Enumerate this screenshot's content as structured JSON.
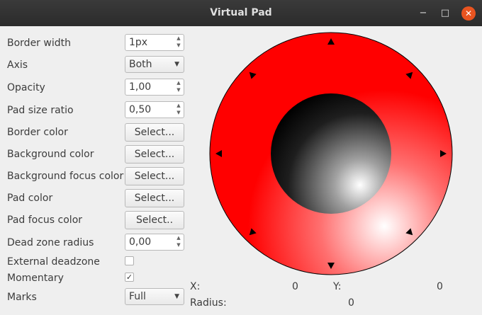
{
  "window": {
    "title": "Virtual Pad",
    "minimize": "−",
    "maximize": "□",
    "close": "✕"
  },
  "settings": {
    "border_width": {
      "label": "Border width",
      "value": "1px"
    },
    "axis": {
      "label": "Axis",
      "value": "Both"
    },
    "opacity": {
      "label": "Opacity",
      "value": "1,00"
    },
    "pad_size_ratio": {
      "label": "Pad size ratio",
      "value": "0,50"
    },
    "border_color": {
      "label": "Border color",
      "button": "Select..."
    },
    "background_color": {
      "label": "Background color",
      "button": "Select..."
    },
    "background_focus_color": {
      "label": "Background focus color",
      "button": "Select..."
    },
    "pad_color": {
      "label": "Pad color",
      "button": "Select..."
    },
    "pad_focus_color": {
      "label": "Pad focus color",
      "button": "Select.."
    },
    "dead_zone_radius": {
      "label": "Dead zone radius",
      "value": "0,00"
    },
    "external_deadzone": {
      "label": "External deadzone",
      "checked": false,
      "mark": ""
    },
    "momentary": {
      "label": "Momentary",
      "checked": true,
      "mark": "✓"
    },
    "marks": {
      "label": "Marks",
      "value": "Full"
    }
  },
  "readout": {
    "x_label": "X:",
    "x_value": "0",
    "y_label": "Y:",
    "y_value": "0",
    "radius_label": "Radius:",
    "radius_value": "0"
  },
  "pad": {
    "background_color": "#ff0000",
    "border_color": "#000000",
    "knob_color": "#000000",
    "marks": "full"
  }
}
